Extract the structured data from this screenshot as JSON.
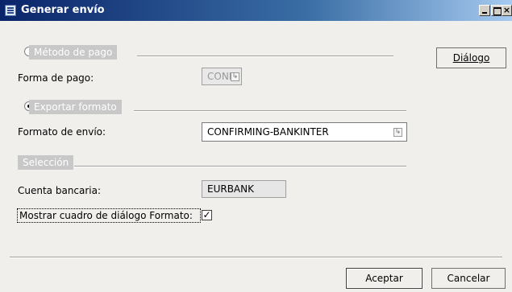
{
  "window": {
    "title": "Generar envío",
    "close_glyph": "×"
  },
  "metodo_pago": {
    "section_label": "Método de pago",
    "forma_label": "Forma de pago:",
    "forma_value": "CONF"
  },
  "exportar": {
    "section_label": "Exportar formato",
    "formato_label": "Formato de envío:",
    "formato_value": "CONFIRMING-BANKINTER"
  },
  "seleccion": {
    "section_label": "Selección",
    "cuenta_label": "Cuenta bancaria:",
    "cuenta_value": "EURBANK",
    "mostrar_label": "Mostrar cuadro de diálogo Formato:",
    "mostrar_checked": true
  },
  "buttons": {
    "dialogo": "Diálogo",
    "aceptar": "Aceptar",
    "cancelar": "Cancelar"
  },
  "icons": {
    "lookup": "lookup-arrow-icon",
    "check": "✓"
  }
}
